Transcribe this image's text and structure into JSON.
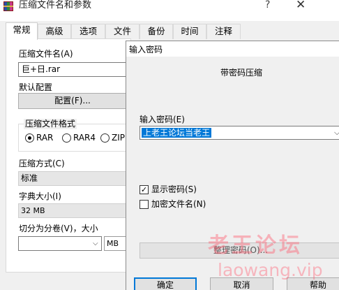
{
  "background_dialog": {
    "title": "压缩文件名和参数",
    "help_symbol": "?",
    "close_symbol": "✕",
    "tabs": [
      {
        "label": "常规"
      },
      {
        "label": "高级"
      },
      {
        "label": "选项"
      },
      {
        "label": "文件"
      },
      {
        "label": "备份"
      },
      {
        "label": "时间"
      },
      {
        "label": "注释"
      }
    ],
    "archive_name_label": "压缩文件名(A)",
    "archive_name_value": "巨+日.rar",
    "default_profile_label": "默认配置",
    "profiles_button": "配置(F)...",
    "format_group_label": "压缩文件格式",
    "formats": [
      {
        "label": "RAR",
        "selected": true
      },
      {
        "label": "RAR4",
        "selected": false
      },
      {
        "label": "ZIP",
        "selected": false
      }
    ],
    "method_label": "压缩方式(C)",
    "method_value": "标准",
    "dict_label": "字典大小(I)",
    "dict_value": "32 MB",
    "split_label": "切分为分卷(V)，大小",
    "split_unit": "MB"
  },
  "password_dialog": {
    "title": "输入密码",
    "heading": "带密码压缩",
    "password_label": "输入密码(E)",
    "password_value": "上老王论坛当老王",
    "show_password": {
      "label": "显示密码(S)",
      "checked": true
    },
    "encrypt_names": {
      "label": "加密文件名(N)",
      "checked": false
    },
    "organize_button": "整理密码(O)...",
    "ok_button": "确定",
    "cancel_button": "取消",
    "help_button": "帮助"
  },
  "watermark": {
    "chinese": "老王论坛",
    "url": "laowang.vip"
  },
  "colors": {
    "selection": "#0078d7",
    "dialog_bg": "#f0f0f0",
    "watermark": "#ff5a6e"
  }
}
